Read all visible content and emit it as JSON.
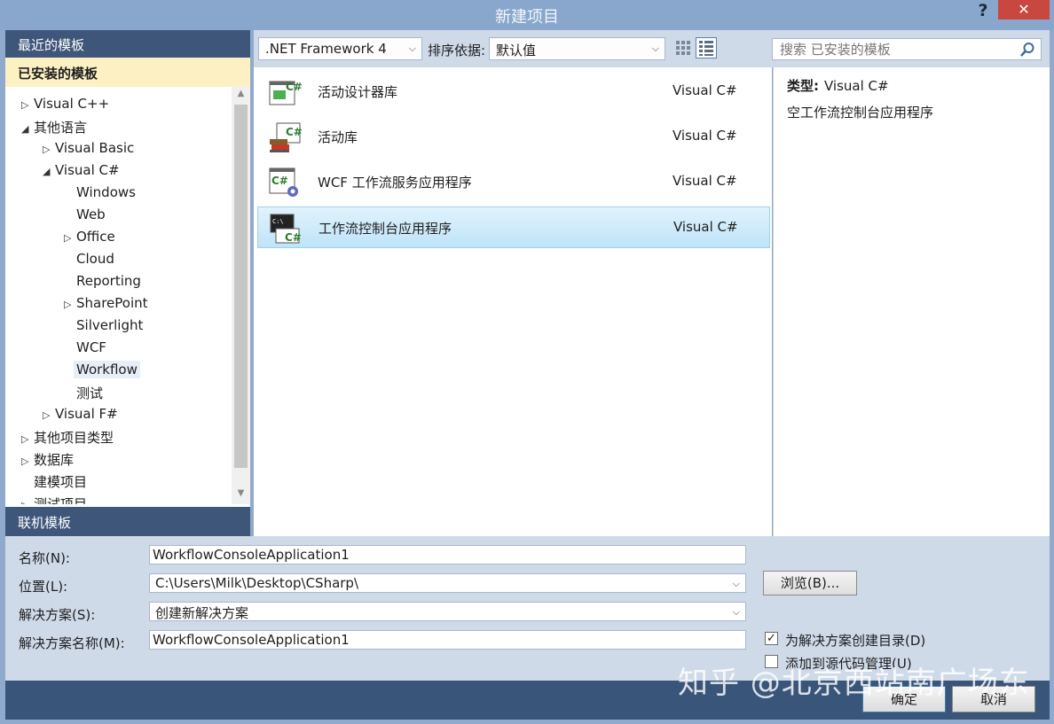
{
  "window": {
    "title": "新建项目",
    "help": "?",
    "close": "✕"
  },
  "left": {
    "recent": "最近的模板",
    "installed": "已安装的模板",
    "online": "联机模板",
    "tree": [
      {
        "label": "Visual C++",
        "depth": 0,
        "arrow": "▷"
      },
      {
        "label": "其他语言",
        "depth": 0,
        "arrow": "◢"
      },
      {
        "label": "Visual Basic",
        "depth": 1,
        "arrow": "▷"
      },
      {
        "label": "Visual C#",
        "depth": 1,
        "arrow": "◢"
      },
      {
        "label": "Windows",
        "depth": 2,
        "arrow": ""
      },
      {
        "label": "Web",
        "depth": 2,
        "arrow": ""
      },
      {
        "label": "Office",
        "depth": 2,
        "arrow": "▷"
      },
      {
        "label": "Cloud",
        "depth": 2,
        "arrow": ""
      },
      {
        "label": "Reporting",
        "depth": 2,
        "arrow": ""
      },
      {
        "label": "SharePoint",
        "depth": 2,
        "arrow": "▷"
      },
      {
        "label": "Silverlight",
        "depth": 2,
        "arrow": ""
      },
      {
        "label": "WCF",
        "depth": 2,
        "arrow": ""
      },
      {
        "label": "Workflow",
        "depth": 2,
        "arrow": "",
        "selected": true
      },
      {
        "label": "测试",
        "depth": 2,
        "arrow": ""
      },
      {
        "label": "Visual F#",
        "depth": 1,
        "arrow": "▷"
      },
      {
        "label": "其他项目类型",
        "depth": 0,
        "arrow": "▷"
      },
      {
        "label": "数据库",
        "depth": 0,
        "arrow": "▷"
      },
      {
        "label": "建模项目",
        "depth": 0,
        "arrow": ""
      },
      {
        "label": "测试项目",
        "depth": 0,
        "arrow": "▷"
      }
    ]
  },
  "toolbar": {
    "framework": ".NET Framework 4",
    "sort_label": "排序依据:",
    "sort_value": "默认值",
    "search_placeholder": "搜索 已安装的模板"
  },
  "templates": [
    {
      "name": "活动设计器库",
      "lang": "Visual C#",
      "icon": "activity-designer-library-icon"
    },
    {
      "name": "活动库",
      "lang": "Visual C#",
      "icon": "activity-library-icon"
    },
    {
      "name": "WCF 工作流服务应用程序",
      "lang": "Visual C#",
      "icon": "wcf-workflow-service-icon"
    },
    {
      "name": "工作流控制台应用程序",
      "lang": "Visual C#",
      "icon": "workflow-console-app-icon",
      "selected": true
    }
  ],
  "detail": {
    "type_label": "类型:",
    "type_value": "Visual C#",
    "description": "空工作流控制台应用程序"
  },
  "form": {
    "name_label": "名称(N):",
    "name_value": "WorkflowConsoleApplication1",
    "location_label": "位置(L):",
    "location_value": "C:\\Users\\Milk\\Desktop\\CSharp\\",
    "browse": "浏览(B)...",
    "solution_label": "解决方案(S):",
    "solution_value": "创建新解决方案",
    "solution_name_label": "解决方案名称(M):",
    "solution_name_value": "WorkflowConsoleApplication1",
    "create_dir_label": "为解决方案创建目录(D)",
    "create_dir_checked": true,
    "source_control_label": "添加到源代码管理(U)",
    "source_control_checked": false
  },
  "buttons": {
    "ok": "确定",
    "cancel": "取消"
  },
  "watermark": "知乎 @北京西站南广场东",
  "colors": {
    "header_dark": "#3e5679",
    "installed_bg": "#fdf1c4",
    "toolbar_bg": "#cfdae9",
    "selection": "#bfe4f8",
    "close": "#c8473f"
  }
}
